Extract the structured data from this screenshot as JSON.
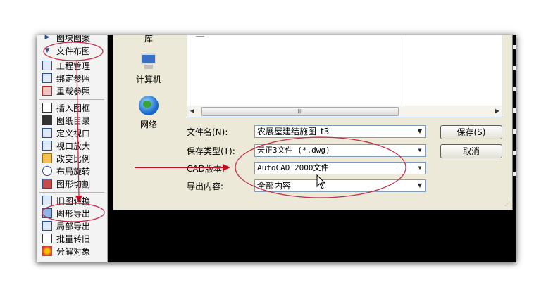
{
  "menu": {
    "items": [
      {
        "label": "图块图案",
        "icon": "block-icon"
      },
      {
        "label": "文件布图",
        "icon": "triangle-expanded-icon"
      },
      {
        "label": "工程管理",
        "icon": "project-icon"
      },
      {
        "label": "绑定参照",
        "icon": "bind-xref-icon"
      },
      {
        "label": "重载参照",
        "icon": "reload-xref-icon"
      },
      {
        "label": "插入图框",
        "icon": "insert-frame-icon"
      },
      {
        "label": "图纸目录",
        "icon": "drawing-list-icon"
      },
      {
        "label": "定义视口",
        "icon": "define-viewport-icon"
      },
      {
        "label": "视口放大",
        "icon": "zoom-viewport-icon"
      },
      {
        "label": "改变比例",
        "icon": "change-scale-icon"
      },
      {
        "label": "布局旋转",
        "icon": "rotate-layout-icon"
      },
      {
        "label": "图形切割",
        "icon": "cut-drawing-icon"
      },
      {
        "label": "旧图转换",
        "icon": "convert-old-icon"
      },
      {
        "label": "图形导出",
        "icon": "export-drawing-icon"
      },
      {
        "label": "局部导出",
        "icon": "partial-export-icon"
      },
      {
        "label": "批量转旧",
        "icon": "batch-convert-icon"
      },
      {
        "label": "分解对象",
        "icon": "explode-object-icon"
      }
    ]
  },
  "dialog": {
    "places": [
      {
        "label": "库",
        "icon": "library-icon"
      },
      {
        "label": "计算机",
        "icon": "computer-icon"
      },
      {
        "label": "网络",
        "icon": "network-icon"
      }
    ],
    "scroll_thumb_glyph": "III",
    "filename": {
      "label": "文件名(N):",
      "value": "农展屋建结施图_t3"
    },
    "save_type": {
      "label": "保存类型(T):",
      "value": "天正3文件 (*.dwg)"
    },
    "cad_version": {
      "label": "CAD版本:",
      "value": "AutoCAD 2000文件"
    },
    "export_content": {
      "label": "导出内容:",
      "value": "全部内容"
    },
    "save_button": "保存(S)",
    "cancel_button": "取消"
  },
  "colors": {
    "annotation": "#c0304a",
    "arrow": "#c01020",
    "dialog_bg": "#ece9d8",
    "menu_bg": "#f3f3f3",
    "field_border": "#7f9db9"
  }
}
